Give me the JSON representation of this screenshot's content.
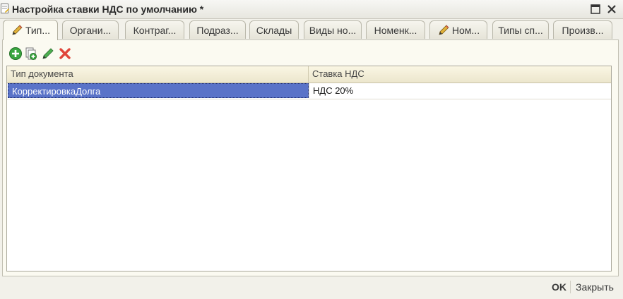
{
  "window": {
    "title": "Настройка ставки НДС по умолчанию *"
  },
  "tabs": [
    {
      "label": "Тип...",
      "icon": "pencil-icon",
      "active": true
    },
    {
      "label": "Органи...",
      "icon": null,
      "active": false
    },
    {
      "label": "Контраг...",
      "icon": null,
      "active": false
    },
    {
      "label": "Подраз...",
      "icon": null,
      "active": false
    },
    {
      "label": "Склады",
      "icon": null,
      "active": false
    },
    {
      "label": "Виды но...",
      "icon": null,
      "active": false
    },
    {
      "label": "Номенк...",
      "icon": null,
      "active": false
    },
    {
      "label": "Ном...",
      "icon": "pencil-icon",
      "active": false
    },
    {
      "label": "Типы сп...",
      "icon": null,
      "active": false
    },
    {
      "label": "Произв...",
      "icon": null,
      "active": false
    }
  ],
  "toolbar": {
    "icons": [
      "add-icon",
      "copy-icon",
      "edit-icon",
      "delete-icon"
    ]
  },
  "table": {
    "columns": [
      "Тип документа",
      "Ставка НДС"
    ],
    "rows": [
      [
        "КорректировкаДолга",
        "НДС 20%"
      ]
    ]
  },
  "footer": {
    "ok_label": "OK",
    "close_label": "Закрыть"
  },
  "colors": {
    "selection": "#5a73c8",
    "window_bg": "#f2f1ea",
    "header_bg": "#ece6cd"
  }
}
